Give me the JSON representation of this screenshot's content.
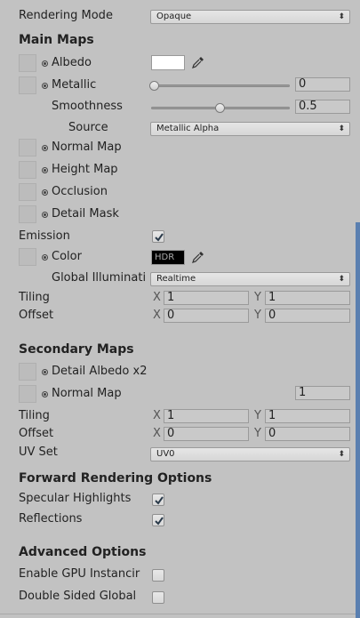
{
  "rendering_mode": {
    "label": "Rendering Mode",
    "value": "Opaque"
  },
  "main_maps": {
    "title": "Main Maps",
    "albedo": "Albedo",
    "albedo_color": "#ffffff",
    "metallic": {
      "label": "Metallic",
      "value": "0",
      "slider_fraction": 0
    },
    "smoothness": {
      "label": "Smoothness",
      "value": "0.5",
      "slider_fraction": 0.5
    },
    "source": {
      "label": "Source",
      "value": "Metallic Alpha"
    },
    "normal_map": "Normal Map",
    "height_map": "Height Map",
    "occlusion": "Occlusion",
    "detail_mask": "Detail Mask",
    "emission": {
      "label": "Emission",
      "checked": true
    },
    "color": {
      "label": "Color",
      "swatch_text": "HDR",
      "swatch_color": "#000000"
    },
    "global_illumination": {
      "label": "Global Illuminati",
      "value": "Realtime"
    },
    "tiling": {
      "label": "Tiling",
      "x": "1",
      "y": "1"
    },
    "offset": {
      "label": "Offset",
      "x": "0",
      "y": "0"
    }
  },
  "secondary_maps": {
    "title": "Secondary Maps",
    "detail_albedo": "Detail Albedo x2",
    "normal_map": {
      "label": "Normal Map",
      "value": "1"
    },
    "tiling": {
      "label": "Tiling",
      "x": "1",
      "y": "1"
    },
    "offset": {
      "label": "Offset",
      "x": "0",
      "y": "0"
    },
    "uv_set": {
      "label": "UV Set",
      "value": "UV0"
    }
  },
  "forward_rendering": {
    "title": "Forward Rendering Options",
    "specular_highlights": {
      "label": "Specular Highlights",
      "checked": true
    },
    "reflections": {
      "label": "Reflections",
      "checked": true
    }
  },
  "advanced": {
    "title": "Advanced Options",
    "gpu_instancing": {
      "label": "Enable GPU Instancir",
      "checked": false
    },
    "double_sided": {
      "label": "Double Sided Global",
      "checked": false
    }
  },
  "axis_labels": {
    "x": "X",
    "y": "Y"
  }
}
